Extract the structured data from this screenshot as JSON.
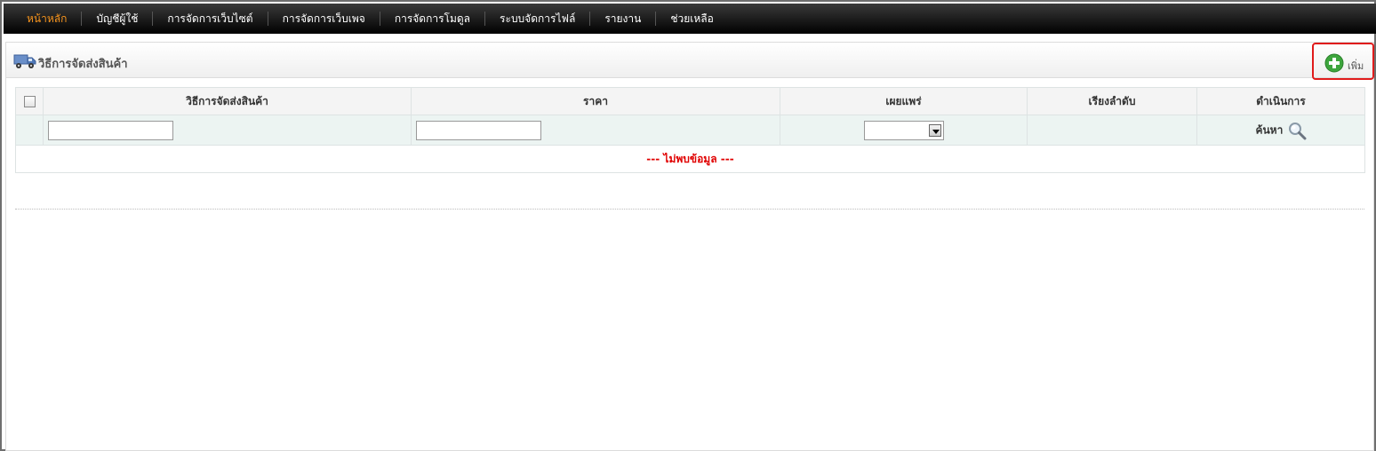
{
  "nav": {
    "items": [
      {
        "label": "หน้าหลัก",
        "active": true
      },
      {
        "label": "บัญชีผู้ใช้",
        "active": false
      },
      {
        "label": "การจัดการเว็บไซต์",
        "active": false
      },
      {
        "label": "การจัดการเว็บเพจ",
        "active": false
      },
      {
        "label": "การจัดการโมดูล",
        "active": false
      },
      {
        "label": "ระบบจัดการไฟล์",
        "active": false
      },
      {
        "label": "รายงาน",
        "active": false
      },
      {
        "label": "ช่วยเหลือ",
        "active": false
      }
    ],
    "active_color": "#f7941d"
  },
  "panel": {
    "title": "วิธีการจัดส่งสินค้า",
    "title_icon": "truck-icon",
    "add_button": {
      "label": "เพิ่ม",
      "icon": "plus-circle-icon",
      "highlight_color": "#e01b1b"
    }
  },
  "table": {
    "columns": [
      "วิธีการจัดส่งสินค้า",
      "ราคา",
      "เผยแพร่",
      "เรียงลำดับ",
      "ดำเนินการ"
    ],
    "filters": {
      "name_value": "",
      "price_value": "",
      "publish_selected": "",
      "search_label": "ค้นหา",
      "search_icon": "magnifier-icon"
    },
    "empty_message": "--- ไม่พบข้อมูล ---",
    "empty_color": "#e00000"
  }
}
